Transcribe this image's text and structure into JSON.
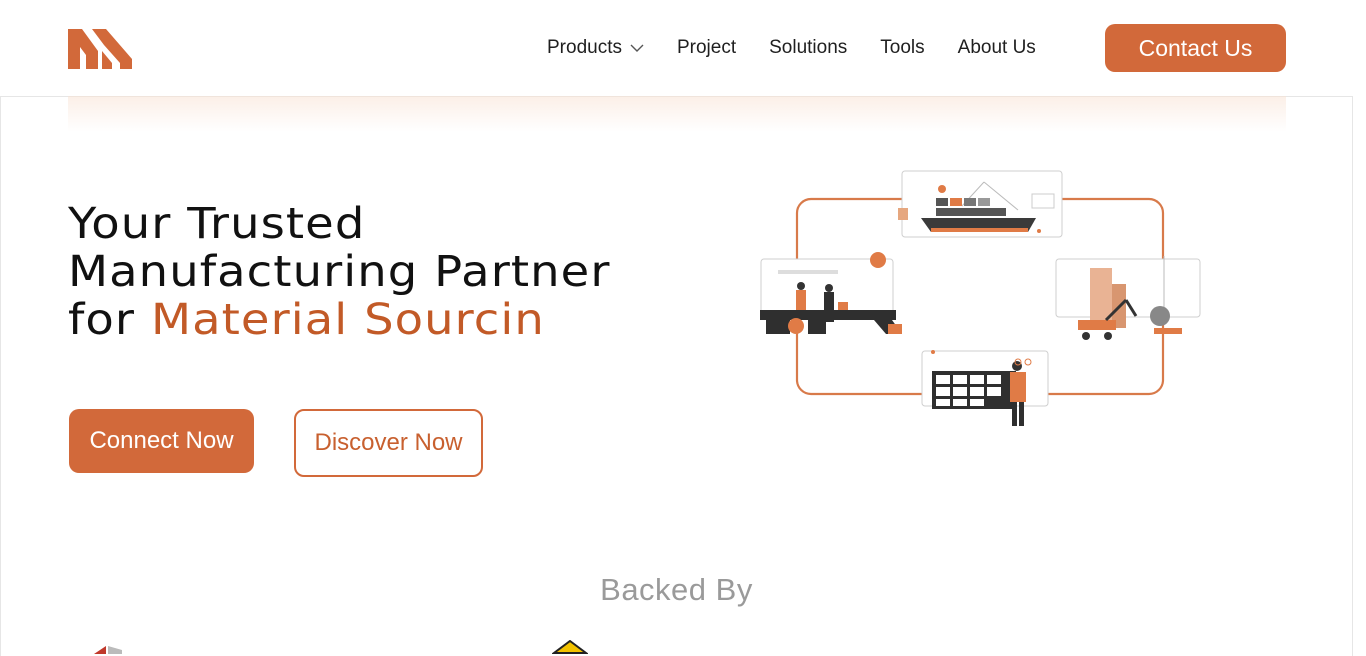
{
  "header": {
    "nav": [
      {
        "label": "Products",
        "has_dropdown": true
      },
      {
        "label": "Project"
      },
      {
        "label": "Solutions"
      },
      {
        "label": "Tools"
      },
      {
        "label": "About Us"
      }
    ],
    "contact_label": "Contact Us"
  },
  "hero": {
    "title_line1": "Your Trusted",
    "title_line2": "Manufacturing Partner",
    "title_line3_prefix": "for ",
    "title_line3_accent": "Material Sourcin",
    "primary_button": "Connect Now",
    "secondary_button": "Discover Now"
  },
  "backed_by": {
    "heading": "Backed By"
  },
  "colors": {
    "brand": "#d2693a",
    "accent_text": "#c25a27",
    "muted": "#9a9a9a"
  },
  "icons": [
    "logo-icon",
    "chevron-down-icon"
  ]
}
